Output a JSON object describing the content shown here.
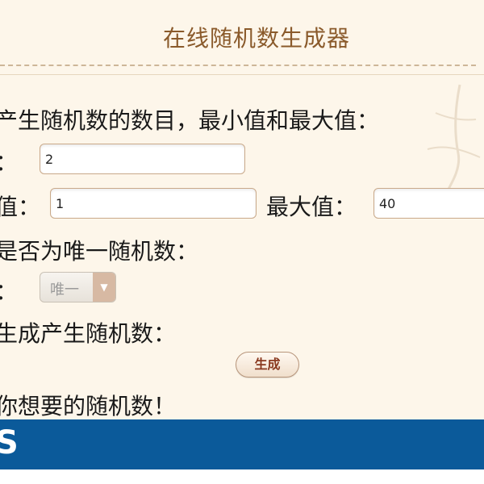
{
  "page": {
    "title": "在线随机数生成器"
  },
  "form": {
    "intro": "产生随机数的数目，最小值和最大值：",
    "count_label": "：",
    "count_value": "2",
    "min_label": "值：",
    "min_value": "1",
    "max_label": "最大值：",
    "max_value": "40",
    "unique_label": "是否为唯一随机数：",
    "unique_prefix": "：",
    "unique_selected": "唯一",
    "generate_prompt": "生成产生随机数：",
    "generate_button": "生成",
    "result_text": "你想要的随机数！"
  },
  "footer": {
    "text": "S"
  },
  "colors": {
    "title_color": "#8a5a2b",
    "panel_background": "#fdf6ea",
    "footer_blue": "#0b5a9a"
  },
  "icons": {
    "select_arrow": "chevron-down-icon"
  }
}
